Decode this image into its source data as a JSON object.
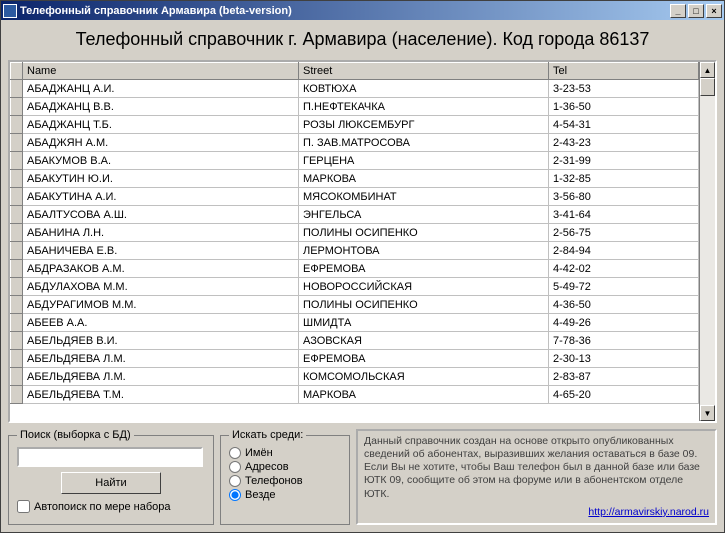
{
  "window": {
    "title": "Телефонный справочник Армавира (beta-version)"
  },
  "heading": "Телефонный справочник г. Армавира (население). Код города 86137",
  "columns": {
    "name": "Name",
    "street": "Street",
    "tel": "Tel"
  },
  "rows": [
    {
      "name": "АБАДЖАНЦ А.И.",
      "street": "КОВТЮХА",
      "tel": "3-23-53"
    },
    {
      "name": "АБАДЖАНЦ В.В.",
      "street": "П.НЕФТЕКАЧКА",
      "tel": "1-36-50"
    },
    {
      "name": "АБАДЖАНЦ Т.Б.",
      "street": "РОЗЫ ЛЮКСЕМБУРГ",
      "tel": "4-54-31"
    },
    {
      "name": "АБАДЖЯН А.М.",
      "street": "П. ЗАВ.МАТРОСОВА",
      "tel": "2-43-23"
    },
    {
      "name": "АБАКУМОВ В.А.",
      "street": "ГЕРЦЕНА",
      "tel": "2-31-99"
    },
    {
      "name": "АБАКУТИН Ю.И.",
      "street": "МАРКОВА",
      "tel": "1-32-85"
    },
    {
      "name": "АБАКУТИНА А.И.",
      "street": "МЯСОКОМБИНАТ",
      "tel": "3-56-80"
    },
    {
      "name": "АБАЛТУСОВА А.Ш.",
      "street": "ЭНГЕЛЬСА",
      "tel": "3-41-64"
    },
    {
      "name": "АБАНИНА Л.Н.",
      "street": "ПОЛИНЫ ОСИПЕНКО",
      "tel": "2-56-75"
    },
    {
      "name": "АБАНИЧЕВА Е.В.",
      "street": "ЛЕРМОНТОВА",
      "tel": "2-84-94"
    },
    {
      "name": "АБДРАЗАКОВ А.М.",
      "street": "ЕФРЕМОВА",
      "tel": "4-42-02"
    },
    {
      "name": "АБДУЛАХОВА М.М.",
      "street": "НОВОРОССИЙСКАЯ",
      "tel": "5-49-72"
    },
    {
      "name": "АБДУРАГИМОВ М.М.",
      "street": "ПОЛИНЫ ОСИПЕНКО",
      "tel": "4-36-50"
    },
    {
      "name": "АБЕЕВ А.А.",
      "street": "ШМИДТА",
      "tel": "4-49-26"
    },
    {
      "name": "АБЕЛЬДЯЕВ В.И.",
      "street": "АЗОВСКАЯ",
      "tel": "7-78-36"
    },
    {
      "name": "АБЕЛЬДЯЕВА Л.М.",
      "street": "ЕФРЕМОВА",
      "tel": "2-30-13"
    },
    {
      "name": "АБЕЛЬДЯЕВА Л.М.",
      "street": "КОМСОМОЛЬСКАЯ",
      "tel": "2-83-87"
    },
    {
      "name": "АБЕЛЬДЯЕВА Т.М.",
      "street": "МАРКОВА",
      "tel": "4-65-20"
    }
  ],
  "search": {
    "legend": "Поиск (выборка с БД)",
    "button": "Найти",
    "autosearch": "Автопоиск по мере набора"
  },
  "among": {
    "legend": "Искать среди:",
    "o1": "Имён",
    "o2": "Адресов",
    "o3": "Телефонов",
    "o4": "Везде"
  },
  "info": {
    "text": "Данный справочник создан на основе открыто опубликованных сведений об абонентах, выразивших желания оставаться в базе 09. Если Вы не хотите, чтобы Ваш телефон был в данной базе или базе ЮТК 09, сообщите об этом на форуме или в абонентском отделе ЮТК.",
    "link": "http://armavirskiy.narod.ru"
  }
}
